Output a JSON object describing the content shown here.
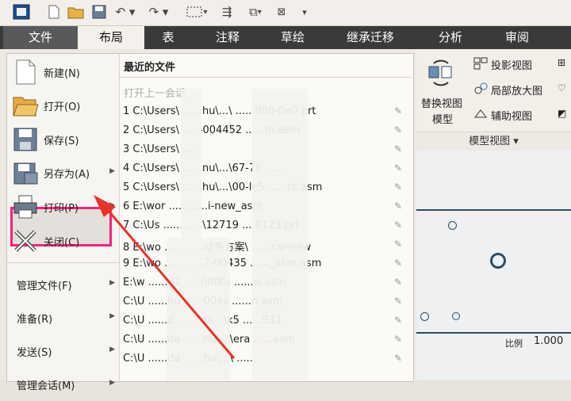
{
  "quick_access": {
    "icons": [
      "app-icon",
      "new-icon",
      "open-icon",
      "save-icon",
      "undo-icon",
      "redo-icon",
      "select-box-icon",
      "regen-icon",
      "window-icon",
      "close-window-icon",
      "customize-icon"
    ]
  },
  "tabs": [
    "文件",
    "布局",
    "表",
    "注释",
    "草绘",
    "继承迁移",
    "分析",
    "审阅"
  ],
  "ribbon": {
    "replace_view": "替换视图",
    "replace_view_line2": "模型",
    "projection_view": "投影视图",
    "detail_view": "局部放大图",
    "aux_view": "辅助视图",
    "group_label": "模型视图",
    "scale_label": "比例",
    "scale_value": "1.000"
  },
  "file_menu": {
    "new": "新建(N)",
    "open": "打开(O)",
    "save": "保存(S)",
    "save_as": "另存为(A)",
    "print": "打印(P)",
    "close": "关闭(C)",
    "manage_file": "管理文件(F)",
    "prepare": "准备(R)",
    "send": "发送(S)",
    "manage_session": "管理会话(M)"
  },
  "recent": {
    "title": "最近的文件",
    "subtitle": "打开上一会话",
    "items": [
      "1 C:\\Users\\ ......hu\\...\\ ......980-0e0.prt",
      "2 C:\\Users\\ .... -004452 ......m.asm",
      "3 C:\\Users\\ ....",
      "4 C:\\Users\\ ......nu\\...\\67-76 ......",
      "5 C:\\Users\\ ......hu\\...\\00-le5 ......tc.asm",
      "6 E:\\wor ............i-new_asm",
      "7 C:\\Us ............\\12719 ....0123.prt",
      "8 E:\\wo ............动条方案\\ ......cai-new",
      "9 E:\\wo ............7-00435 ......_asm.asm",
      "E:\\w ......01 ....2\\00fu ......w.asm",
      "C:\\U ......hu ......00as ......n.asm",
      "C:\\U ......d ......hu\\...\\k5 ......931.",
      "C:\\U ......da ......nu\\...\\era ......asm",
      "C:\\U ......da ......hu\\...\\ ......"
    ]
  }
}
